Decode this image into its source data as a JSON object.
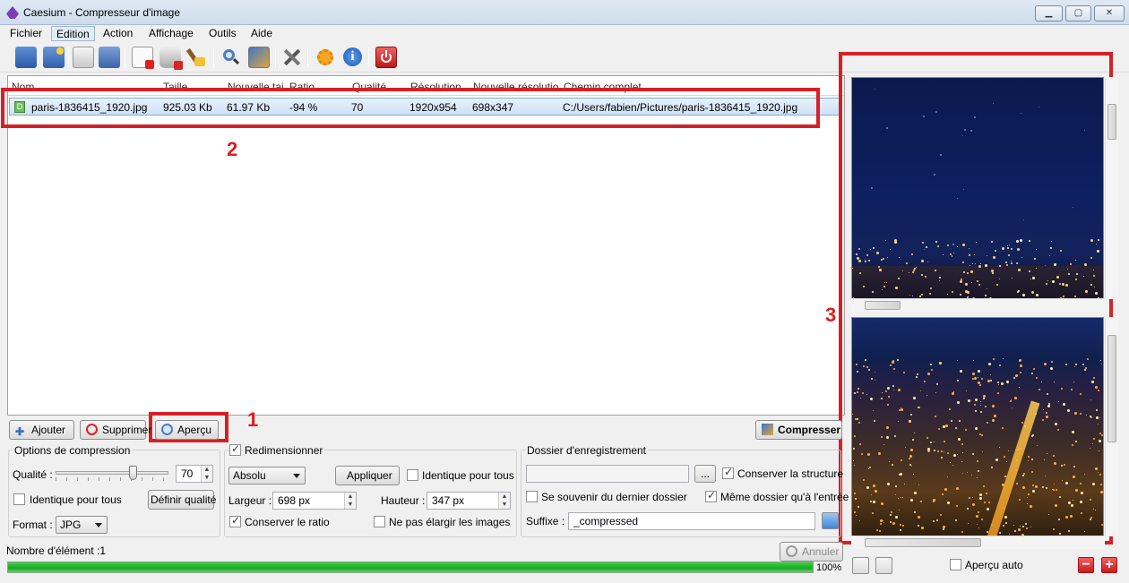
{
  "window": {
    "title": "Caesium - Compresseur d'image"
  },
  "menu": [
    "Fichier",
    "Edition",
    "Action",
    "Affichage",
    "Outils",
    "Aide"
  ],
  "toolbar_icons": [
    "open-icon",
    "add-folder-icon",
    "save-icon",
    "save-all-icon",
    "remove-icon",
    "clear-list-icon",
    "clean-icon",
    "preview-icon",
    "compare-icon",
    "settings-icon",
    "plugins-icon",
    "info-icon",
    "exit-icon"
  ],
  "list": {
    "columns": [
      "Nom",
      "Taille",
      "Nouvelle tai...",
      "Ratio",
      "Qualité",
      "Résolution",
      "Nouvelle résolutio...",
      "Chemin complet"
    ],
    "rows": [
      {
        "name": "paris-1836415_1920.jpg",
        "size": "925.03 Kb",
        "new_size": "61.97 Kb",
        "ratio": "-94 %",
        "quality": "70",
        "resolution": "1920x954",
        "new_resolution": "698x347",
        "path": "C:/Users/fabien/Pictures/paris-1836415_1920.jpg"
      }
    ]
  },
  "annotations": {
    "n1": "1",
    "n2": "2",
    "n3": "3"
  },
  "actions": {
    "add": "Ajouter",
    "remove": "Supprimer",
    "preview": "Aperçu",
    "compress": "Compresser"
  },
  "compression": {
    "legend": "Options de compression",
    "quality_label": "Qualité :",
    "quality_value": "70",
    "quality_fraction": 0.7,
    "same_for_all": "Identique pour tous",
    "define_quality": "Définir qualité",
    "format_label": "Format :",
    "format_value": "JPG"
  },
  "resize": {
    "legend": "Redimensionner",
    "mode": "Absolu",
    "apply": "Appliquer",
    "same_for_all": "Identique pour tous",
    "width_label": "Largeur :",
    "width_value": "698 px",
    "height_label": "Hauteur :",
    "height_value": "347 px",
    "keep_ratio": "Conserver le ratio",
    "no_enlarge": "Ne pas élargir les images"
  },
  "output": {
    "legend": "Dossier d'enregistrement",
    "browse": "...",
    "keep_structure": "Conserver la structure",
    "remember_folder": "Se souvenir du dernier dossier",
    "same_folder": "Même dossier qu'à l'entrée",
    "suffix_label": "Suffixe :",
    "suffix_value": "_compressed"
  },
  "status": {
    "count": "Nombre d'élément :1",
    "cancel": "Annuler",
    "progress_text": "100%",
    "progress_fraction": 1.0
  },
  "preview_panel": {
    "auto_preview": "Aperçu auto"
  },
  "colors": {
    "annotation_red": "#d81f26",
    "progress_green": "#19a826",
    "selection_blue": "#cde1f7"
  }
}
